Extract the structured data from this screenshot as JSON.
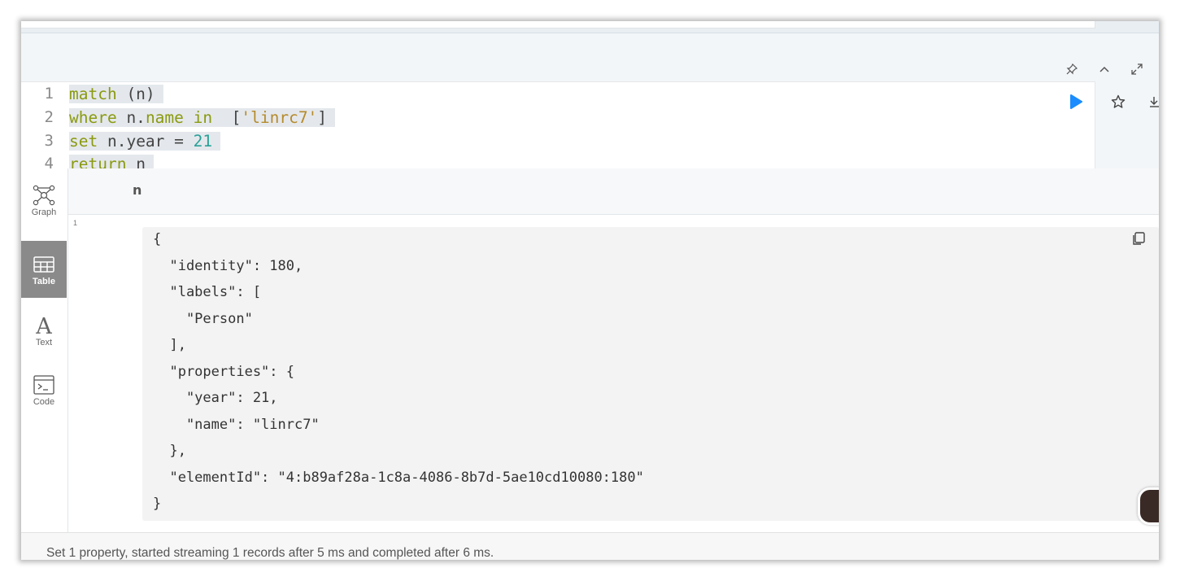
{
  "editor": {
    "lines": [
      {
        "number": "1"
      },
      {
        "number": "2"
      },
      {
        "number": "3"
      },
      {
        "number": "4"
      }
    ],
    "tokens": {
      "match": "match",
      "n_open": " (n)",
      "where": "where",
      "n_name_prefix": " n.",
      "name": "name",
      "in": " in",
      "list_open": "  [",
      "linrc7": "'linrc7'",
      "list_close": "]",
      "set": "set",
      "n_year": " n.year = ",
      "year_value": "21",
      "return": "return",
      "return_n": " n"
    }
  },
  "view_tabs": [
    {
      "label": "Graph",
      "icon": "graph-icon"
    },
    {
      "label": "Table",
      "icon": "table-icon",
      "active": true
    },
    {
      "label": "Text",
      "icon": "text-icon"
    },
    {
      "label": "Code",
      "icon": "code-icon"
    }
  ],
  "result": {
    "column_header": "n",
    "row_index": "1",
    "json_lines": [
      "{",
      "  \"identity\": 180,",
      "  \"labels\": [",
      "    \"Person\"",
      "  ],",
      "  \"properties\": {",
      "    \"year\": 21,",
      "    \"name\": \"linrc7\"",
      "  },",
      "  \"elementId\": \"4:b89af28a-1c8a-4086-8b7d-5ae10cd10080:180\"",
      "}"
    ]
  },
  "footer": {
    "status": "Set 1 property, started streaming 1 records after 5 ms and completed after 6 ms."
  },
  "colors": {
    "run_button": "#1a8cff",
    "active_tab": "#8a8a8a",
    "keyword": "#8a9a10",
    "string": "#b58a2b",
    "number": "#2aa198"
  }
}
